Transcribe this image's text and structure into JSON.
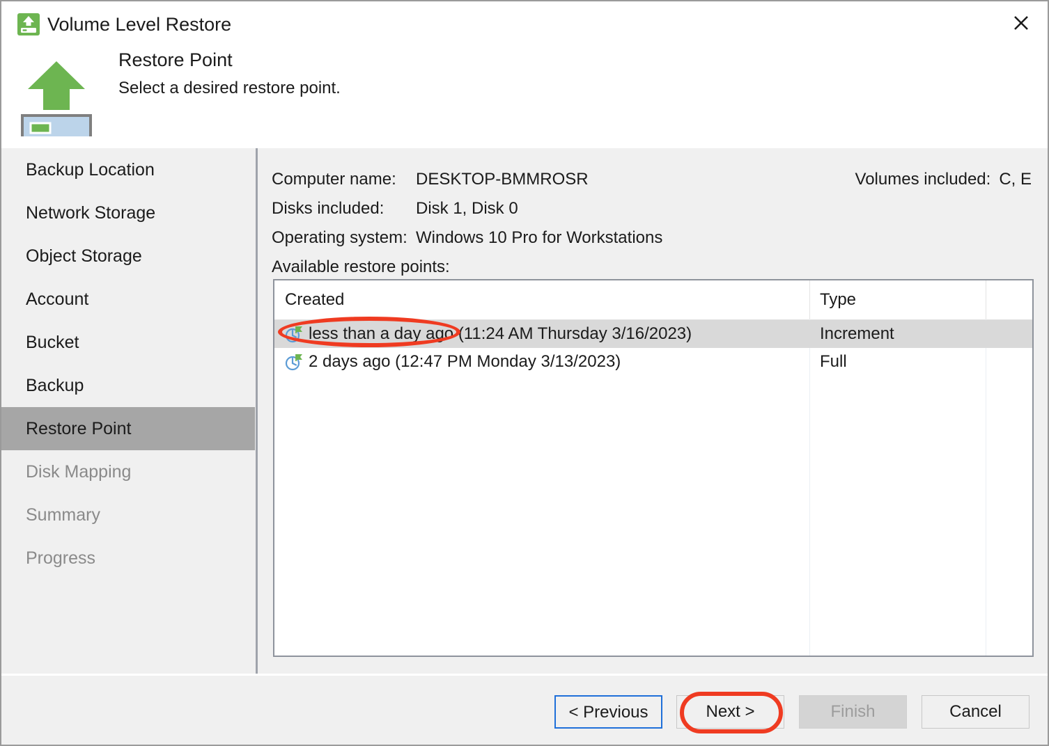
{
  "window": {
    "title": "Volume Level Restore",
    "title_icon": "volume-restore-icon",
    "close_icon": "close-icon"
  },
  "header": {
    "icon": "volume-restore-large-icon",
    "title": "Restore Point",
    "subtitle": "Select a desired restore point."
  },
  "sidebar": {
    "items": [
      {
        "label": "Backup Location",
        "state": "enabled"
      },
      {
        "label": "Network Storage",
        "state": "enabled"
      },
      {
        "label": "Object Storage",
        "state": "enabled"
      },
      {
        "label": "Account",
        "state": "enabled"
      },
      {
        "label": "Bucket",
        "state": "enabled"
      },
      {
        "label": "Backup",
        "state": "enabled"
      },
      {
        "label": "Restore Point",
        "state": "active"
      },
      {
        "label": "Disk Mapping",
        "state": "disabled"
      },
      {
        "label": "Summary",
        "state": "disabled"
      },
      {
        "label": "Progress",
        "state": "disabled"
      }
    ]
  },
  "main": {
    "info": {
      "computer_name_label": "Computer name:",
      "computer_name_value": "DESKTOP-BMMROSR",
      "disks_label": "Disks included:",
      "disks_value": "Disk 1, Disk 0",
      "os_label": "Operating system:",
      "os_value": "Windows 10 Pro for Workstations",
      "volumes_label": "Volumes included:",
      "volumes_value": "C, E"
    },
    "list_caption": "Available restore points:",
    "table": {
      "columns": [
        "Created",
        "Type"
      ],
      "rows": [
        {
          "icon": "restore-point-clock-icon",
          "created": "less than a day ago (11:24 AM Thursday 3/16/2023)",
          "type": "Increment",
          "selected": true
        },
        {
          "icon": "restore-point-clock-icon",
          "created": "2 days ago (12:47 PM Monday 3/13/2023)",
          "type": "Full",
          "selected": false
        }
      ]
    }
  },
  "footer": {
    "previous_label": "< Previous",
    "next_label": "Next >",
    "finish_label": "Finish",
    "cancel_label": "Cancel"
  },
  "annotations": {
    "highlight_color": "#ef3b21",
    "targets": [
      "restore-point-row-1",
      "next-button"
    ]
  },
  "colors": {
    "accent_green": "#6db551",
    "selection_gray": "#a6a6a6",
    "row_selection": "#d9d9d9",
    "focus_blue": "#1e6fd9",
    "annotation_red": "#ef3b21"
  }
}
